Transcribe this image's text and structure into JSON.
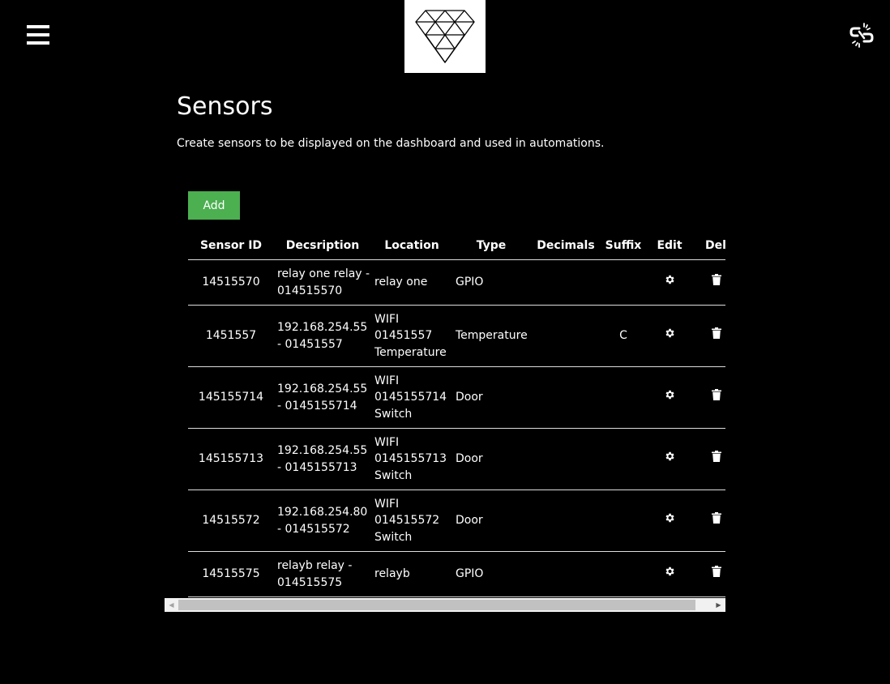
{
  "header": {
    "menu_icon": "hamburger-menu-icon",
    "logo_icon": "diamond-logo",
    "connection_icon": "broken-link-icon"
  },
  "page": {
    "title": "Sensors",
    "description": "Create sensors to be displayed on the dashboard and used in automations."
  },
  "actions": {
    "add_label": "Add",
    "add_color": "#4CAF50"
  },
  "table": {
    "columns": [
      "Sensor ID",
      "Decsription",
      "Location",
      "Type",
      "Decimals",
      "Suffix",
      "Edit",
      "Dele"
    ],
    "rows": [
      {
        "id": "14515570",
        "description": "relay one relay - 014515570",
        "location": "relay one",
        "type": "GPIO",
        "decimals": "",
        "suffix": ""
      },
      {
        "id": "1451557",
        "description": "192.168.254.55 - 01451557",
        "location": "WIFI 01451557 Temperature",
        "type": "Temperature",
        "decimals": "",
        "suffix": "C"
      },
      {
        "id": "145155714",
        "description": "192.168.254.55 - 0145155714",
        "location": "WIFI 0145155714 Switch",
        "type": "Door",
        "decimals": "",
        "suffix": ""
      },
      {
        "id": "145155713",
        "description": "192.168.254.55 - 0145155713",
        "location": "WIFI 0145155713 Switch",
        "type": "Door",
        "decimals": "",
        "suffix": ""
      },
      {
        "id": "14515572",
        "description": "192.168.254.80 - 014515572",
        "location": "WIFI 014515572 Switch",
        "type": "Door",
        "decimals": "",
        "suffix": ""
      },
      {
        "id": "14515575",
        "description": "relayb relay - 014515575",
        "location": "relayb",
        "type": "GPIO",
        "decimals": "",
        "suffix": ""
      }
    ],
    "edit_icon": "gear-icon",
    "delete_icon": "trash-icon"
  }
}
